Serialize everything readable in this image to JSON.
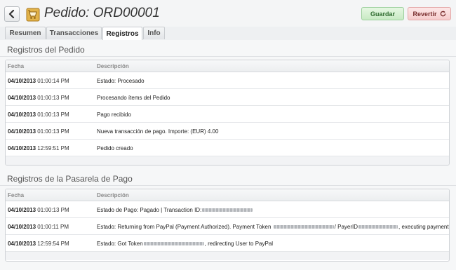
{
  "header": {
    "title": "Pedido: ORD00001",
    "save_label": "Guardar",
    "revert_label": "Revertir",
    "back_icon": "chevron-left-icon",
    "cart_icon": "shopping-cart-icon",
    "refresh_icon": "refresh-icon"
  },
  "tabs": [
    {
      "label": "Resumen",
      "active": false
    },
    {
      "label": "Transacciones",
      "active": false
    },
    {
      "label": "Registros",
      "active": true
    },
    {
      "label": "Info",
      "active": false
    }
  ],
  "order_log": {
    "title": "Registros del Pedido",
    "columns": {
      "date": "Fecha",
      "description": "Descripción"
    },
    "rows": [
      {
        "date": "04/10/2013",
        "time": "01:00:14 PM",
        "description": "Estado: Procesado"
      },
      {
        "date": "04/10/2013",
        "time": "01:00:13 PM",
        "description": "Procesando ítems del Pedido"
      },
      {
        "date": "04/10/2013",
        "time": "01:00:13 PM",
        "description": "Pago recibido"
      },
      {
        "date": "04/10/2013",
        "time": "01:00:13 PM",
        "description": "Nueva transacción de pago. Importe: (EUR) 4.00"
      },
      {
        "date": "04/10/2013",
        "time": "12:59:51 PM",
        "description": "Pedido creado"
      }
    ]
  },
  "gateway_log": {
    "title": "Registros de la Pasarela de Pago",
    "columns": {
      "date": "Fecha",
      "description": "Descripción"
    },
    "rows": [
      {
        "date": "04/10/2013",
        "time": "01:00:13 PM",
        "desc_a": "Estado de Pago: Pagado | Transaction ID:"
      },
      {
        "date": "04/10/2013",
        "time": "01:00:11 PM",
        "desc_a": "Estado: Returning from PayPal (Payment Authorized). Payment Token",
        "desc_b": "/ PayerID",
        "desc_c": ", executing payment"
      },
      {
        "date": "04/10/2013",
        "time": "12:59:54 PM",
        "desc_a": "Estado: Got Token",
        "desc_b": ", redirecting User to PayPal"
      }
    ]
  }
}
